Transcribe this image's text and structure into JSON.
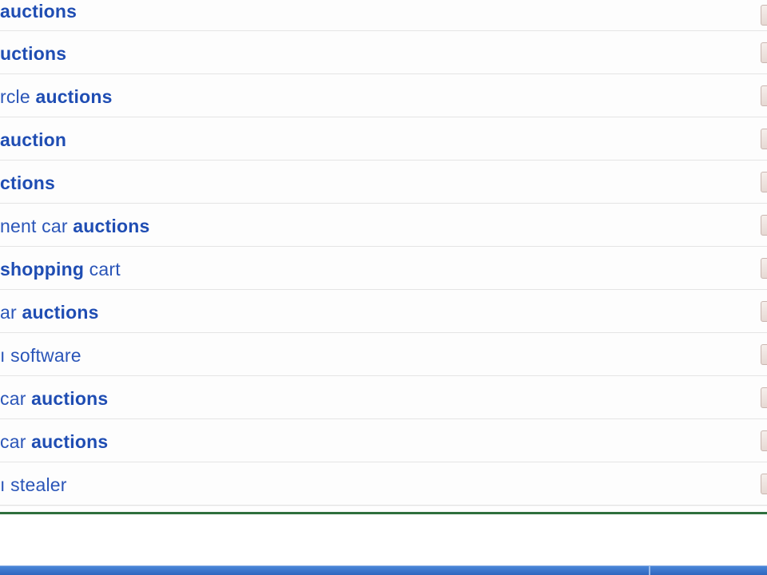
{
  "rows": [
    {
      "segments": [
        {
          "text": "auctions",
          "bold": true
        }
      ]
    },
    {
      "segments": [
        {
          "text": "uctions",
          "bold": true
        }
      ]
    },
    {
      "segments": [
        {
          "text": "rcle ",
          "bold": false
        },
        {
          "text": "auctions",
          "bold": true
        }
      ]
    },
    {
      "segments": [
        {
          "text": " auction",
          "bold": true
        }
      ]
    },
    {
      "segments": [
        {
          "text": "ctions",
          "bold": true
        }
      ]
    },
    {
      "segments": [
        {
          "text": "nent car ",
          "bold": false
        },
        {
          "text": "auctions",
          "bold": true
        }
      ]
    },
    {
      "segments": [
        {
          "text": "shopping",
          "bold": true
        },
        {
          "text": " cart",
          "bold": false
        }
      ]
    },
    {
      "segments": [
        {
          "text": "ar ",
          "bold": false
        },
        {
          "text": "auctions",
          "bold": true
        }
      ]
    },
    {
      "segments": [
        {
          "text": "ı software",
          "bold": false
        }
      ]
    },
    {
      "segments": [
        {
          "text": "car ",
          "bold": false
        },
        {
          "text": "auctions",
          "bold": true
        }
      ]
    },
    {
      "segments": [
        {
          "text": "car ",
          "bold": false
        },
        {
          "text": "auctions",
          "bold": true
        }
      ]
    },
    {
      "segments": [
        {
          "text": "ı stealer",
          "bold": false
        }
      ]
    }
  ],
  "colors": {
    "link": "#2a55b8",
    "link_bold": "#1f4db3",
    "divider": "#2f6f3e",
    "taskbar": "#3a74cc"
  }
}
